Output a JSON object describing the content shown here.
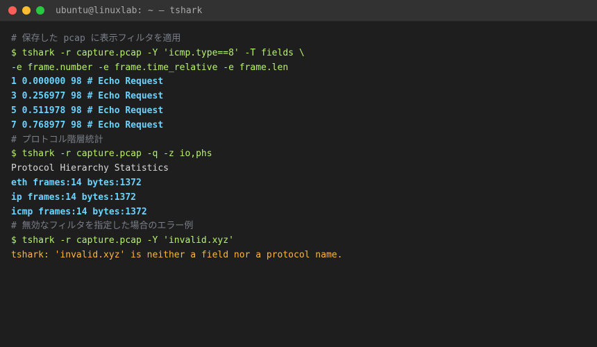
{
  "window": {
    "title": "ubuntu@linuxlab: ~ — tshark"
  },
  "lines": [
    {
      "kind": "comment",
      "text": "# 保存した pcap に表示フィルタを適用"
    },
    {
      "kind": "cmd",
      "text": "$ tshark -r capture.pcap -Y 'icmp.type==8' -T fields \\"
    },
    {
      "kind": "cmd",
      "text": "-e frame.number -e frame.time_relative -e frame.len"
    },
    {
      "kind": "out-bold",
      "text": "1 0.000000 98 # Echo Request"
    },
    {
      "kind": "out-bold",
      "text": "3 0.256977 98 # Echo Request"
    },
    {
      "kind": "out-bold",
      "text": "5 0.511978 98 # Echo Request"
    },
    {
      "kind": "out-bold",
      "text": "7 0.768977 98 # Echo Request"
    },
    {
      "kind": "comment",
      "text": "# プロトコル階層統計"
    },
    {
      "kind": "cmd",
      "text": "$ tshark -r capture.pcap -q -z io,phs"
    },
    {
      "kind": "out-plain",
      "text": "Protocol Hierarchy Statistics"
    },
    {
      "kind": "out-bold",
      "text": "eth frames:14 bytes:1372"
    },
    {
      "kind": "out-bold",
      "text": "ip frames:14 bytes:1372"
    },
    {
      "kind": "out-bold",
      "text": "icmp frames:14 bytes:1372"
    },
    {
      "kind": "comment",
      "text": "# 無効なフィルタを指定した場合のエラー例"
    },
    {
      "kind": "cmd",
      "text": "$ tshark -r capture.pcap -Y 'invalid.xyz'"
    },
    {
      "kind": "err",
      "text": "tshark: 'invalid.xyz' is neither a field nor a protocol name."
    }
  ]
}
